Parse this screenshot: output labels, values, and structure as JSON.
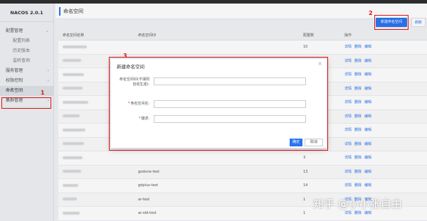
{
  "sidebar": {
    "brand": "NACOS 2.0.1",
    "groups": [
      {
        "label": "配置管理",
        "chevron": "⌄"
      },
      {
        "label": "服务管理",
        "chevron": "›"
      },
      {
        "label": "权限控制",
        "chevron": "›"
      },
      {
        "label": "集群管理",
        "chevron": "›"
      }
    ],
    "sub_items": [
      "配置列表",
      "历史版本",
      "监听查询"
    ],
    "active_item": "命名空间"
  },
  "header": {
    "title": "命名空间",
    "create_button": "新建命名空间",
    "refresh_button": "刷新"
  },
  "table": {
    "columns": [
      "命名空间名称",
      "命名空间ID",
      "配置数",
      "操作"
    ],
    "rows": [
      {
        "name": "",
        "id": "",
        "count": "10"
      },
      {
        "name": "",
        "id": "",
        "count": ""
      },
      {
        "name": "",
        "id": "",
        "count": ""
      },
      {
        "name": "",
        "id": "",
        "count": ""
      },
      {
        "name": "",
        "id": "",
        "count": ""
      },
      {
        "name": "",
        "id": "",
        "count": ""
      },
      {
        "name": "",
        "id": "",
        "count": ""
      },
      {
        "name": "",
        "id": "",
        "count": ""
      },
      {
        "name": "",
        "id": "",
        "count": "3"
      },
      {
        "name": "",
        "id": "godone-test",
        "count": "13"
      },
      {
        "name": "",
        "id": "gdplus-test",
        "count": "14"
      },
      {
        "name": "",
        "id": "ar-test",
        "count": "1"
      },
      {
        "name": "",
        "id": "ar-old-test",
        "count": "1"
      }
    ],
    "actions": [
      "详情",
      "删除",
      "编辑"
    ]
  },
  "modal": {
    "title": "新建命名空间",
    "field_id_label_line1": "命名空间ID(不填则",
    "field_id_label_line2": "自动生成):",
    "field_name_label": "命名空间名:",
    "field_desc_label": "描述:",
    "required_mark": "*",
    "ok_button": "确定",
    "cancel_button": "取消",
    "close_icon": "×"
  },
  "annotations": {
    "n1": "1",
    "n2": "2",
    "n3": "3",
    "color": "#e01010"
  },
  "watermark": "知乎 @小小张自由",
  "colors": {
    "primary": "#2b74f0",
    "sidebar_bg": "#eef0f3"
  }
}
